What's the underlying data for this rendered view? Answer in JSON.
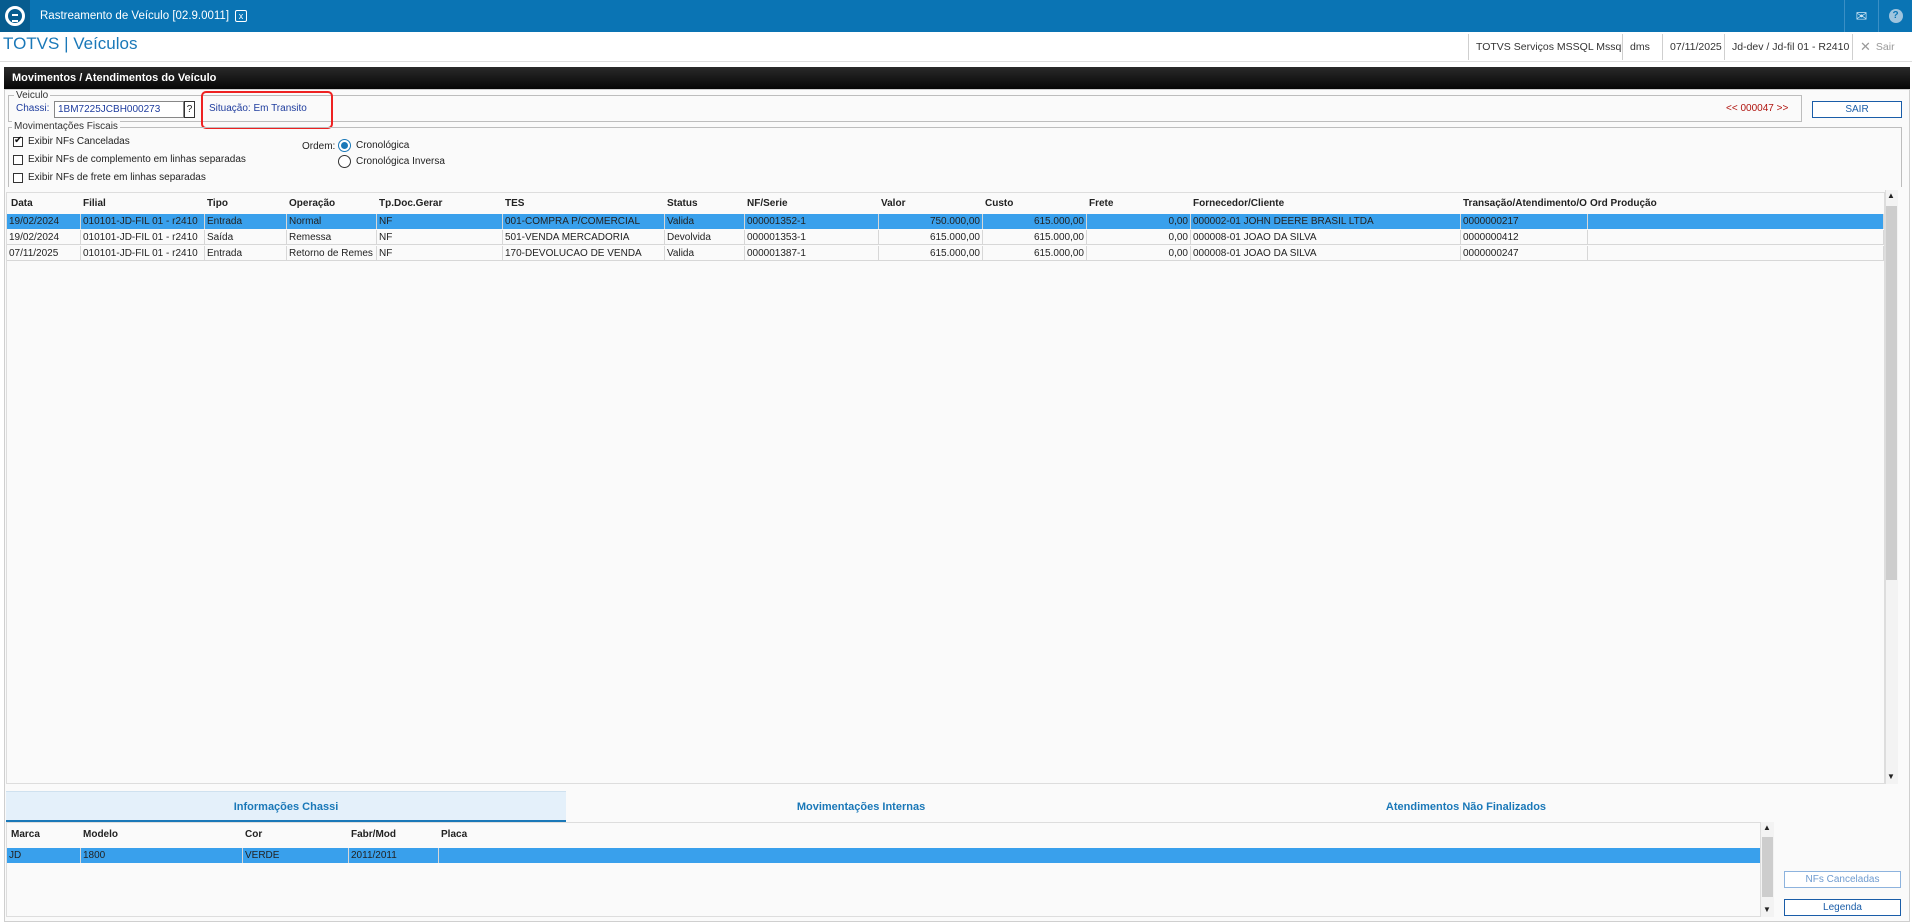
{
  "window": {
    "tab_title": "Rastreamento de Veículo [02.9.0011]",
    "close_glyph": "x"
  },
  "header": {
    "app_title": "TOTVS | Veículos",
    "environment": "TOTVS Serviços MSSQL Mssql",
    "module": "dms",
    "date": "07/11/2025",
    "branch": "Jd-dev / Jd-fil 01 - R2410",
    "logout": "Sair"
  },
  "panel": {
    "title": "Movimentos / Atendimentos do Veículo",
    "veiculo_legend": "Veiculo",
    "chassi_label": "Chassi:",
    "chassi_value": "1BM7225JCBH000273",
    "chassi_help": "?",
    "situacao": "Situação: Em Transito",
    "nav": "<< 000047 >>",
    "sair": "SAIR"
  },
  "fiscal": {
    "legend": "Movimentações Fiscais",
    "options": [
      {
        "label": "Exibir NFs Canceladas",
        "checked": true
      },
      {
        "label": "Exibir NFs de complemento em linhas separadas",
        "checked": false
      },
      {
        "label": "Exibir NFs de frete em linhas separadas",
        "checked": false
      }
    ],
    "ordem_label": "Ordem:",
    "ordem_options": [
      {
        "label": "Cronológica",
        "selected": true
      },
      {
        "label": "Cronológica Inversa",
        "selected": false
      }
    ]
  },
  "grid": {
    "columns": [
      "Data",
      "Filial",
      "Tipo",
      "Operação",
      "Tp.Doc.Gerar",
      "TES",
      "Status",
      "NF/Serie",
      "Valor",
      "Custo",
      "Frete",
      "Fornecedor/Cliente",
      "Transação/Atendimento/O",
      "Ord Produção"
    ],
    "rows": [
      [
        "19/02/2024",
        "010101-JD-FIL 01 - r2410",
        "Entrada",
        "Normal",
        "NF",
        "001-COMPRA P/COMERCIAL",
        "Valida",
        "000001352-1",
        "750.000,00",
        "615.000,00",
        "0,00",
        "000002-01 JOHN DEERE BRASIL LTDA",
        "0000000217",
        ""
      ],
      [
        "19/02/2024",
        "010101-JD-FIL 01 - r2410",
        "Saída",
        "Remessa",
        "NF",
        "501-VENDA MERCADORIA",
        "Devolvida",
        "000001353-1",
        "615.000,00",
        "615.000,00",
        "0,00",
        "000008-01 JOAO DA SILVA",
        "0000000412",
        ""
      ],
      [
        "07/11/2025",
        "010101-JD-FIL 01 - r2410",
        "Entrada",
        "Retorno de Remes",
        "NF",
        "170-DEVOLUCAO DE VENDA",
        "Valida",
        "000001387-1",
        "615.000,00",
        "615.000,00",
        "0,00",
        "000008-01 JOAO DA SILVA",
        "0000000247",
        ""
      ]
    ]
  },
  "bottom_tabs": [
    "Informações Chassi",
    "Movimentações Internas",
    "Atendimentos Não Finalizados"
  ],
  "chassi_grid": {
    "columns": [
      "Marca",
      "Modelo",
      "Cor",
      "Fabr/Mod",
      "Placa"
    ],
    "rows": [
      [
        "JD",
        "1800",
        "VERDE",
        "2011/2011",
        ""
      ]
    ]
  },
  "side_buttons": {
    "nfs_canceladas": "NFs Canceladas",
    "legenda": "Legenda"
  },
  "colors": {
    "brand": "#0a74b4",
    "selection": "#39a0ec",
    "highlight": "#e22222"
  }
}
